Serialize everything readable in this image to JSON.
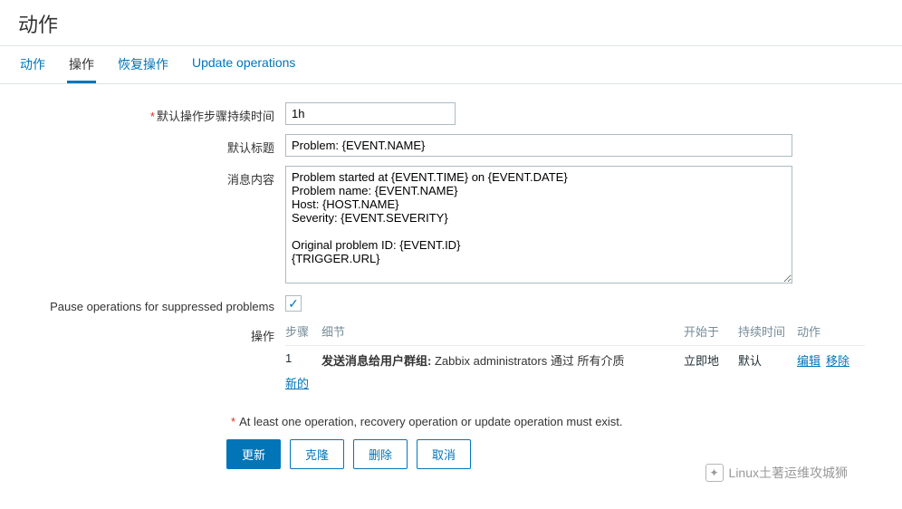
{
  "page": {
    "title": "动作"
  },
  "tabs": [
    {
      "label": "动作"
    },
    {
      "label": "操作"
    },
    {
      "label": "恢复操作"
    },
    {
      "label": "Update operations"
    }
  ],
  "activeTab": 1,
  "form": {
    "stepDuration": {
      "label": "默认操作步骤持续时间",
      "value": "1h"
    },
    "subject": {
      "label": "默认标题",
      "value": "Problem: {EVENT.NAME}"
    },
    "message": {
      "label": "消息内容",
      "value": "Problem started at {EVENT.TIME} on {EVENT.DATE}\nProblem name: {EVENT.NAME}\nHost: {HOST.NAME}\nSeverity: {EVENT.SEVERITY}\n\nOriginal problem ID: {EVENT.ID}\n{TRIGGER.URL}"
    },
    "pause": {
      "label": "Pause operations for suppressed problems",
      "checked": true
    },
    "operations": {
      "label": "操作",
      "headers": {
        "step": "步骤",
        "detail": "细节",
        "start": "开始于",
        "duration": "持续时间",
        "action": "动作"
      },
      "rows": [
        {
          "step": "1",
          "detail_prefix": "发送消息给用户群组:",
          "detail_rest": " Zabbix administrators 通过 所有介质",
          "start": "立即地",
          "duration": "默认",
          "edit": "编辑",
          "remove": "移除"
        }
      ],
      "newLabel": "新的"
    },
    "note": "At least one operation, recovery operation or update operation must exist.",
    "buttons": {
      "update": "更新",
      "clone": "克隆",
      "delete": "删除",
      "cancel": "取消"
    }
  },
  "watermark": "Linux土著运维攻城狮"
}
